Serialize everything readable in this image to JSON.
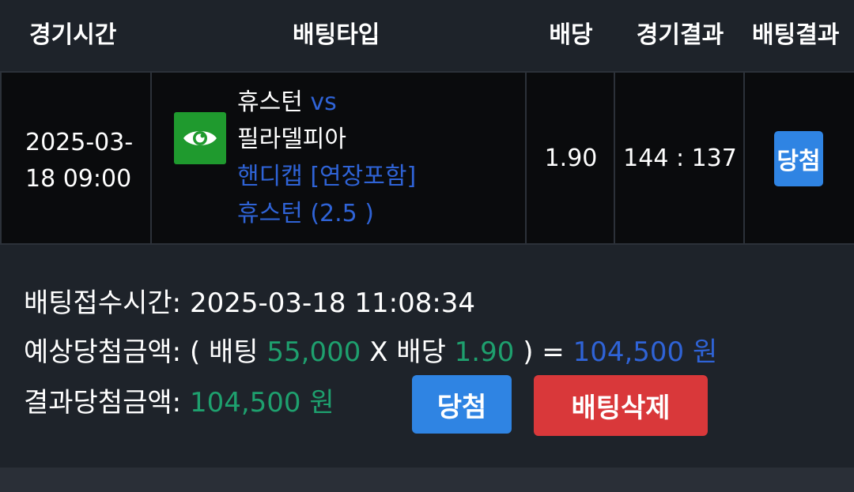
{
  "header": {
    "time": "경기시간",
    "bet_type": "배팅타입",
    "odds": "배당",
    "match_result": "경기결과",
    "bet_result": "배팅결과"
  },
  "row": {
    "time_line1": "2025-03-",
    "time_line2": "18 09:00",
    "icon": "eye-icon",
    "home_team": "휴스턴",
    "vs": "vs",
    "away_team": "필라델피아",
    "market": "핸디캡 [연장포함]",
    "pick": "휴스턴 (2.5 )",
    "odds": "1.90",
    "score": "144 : 137",
    "bet_result_badge": "당첨"
  },
  "summary": {
    "receipt_label": "배팅접수시간:",
    "receipt_time": "2025-03-18 11:08:34",
    "expected_label": "예상당첨금액:",
    "expected_open": "( 배팅",
    "stake": "55,000",
    "times": "X 배당",
    "expected_odds": "1.90",
    "expected_close": ") =",
    "expected_amount": "104,500 원",
    "actual_label": "결과당첨금액:",
    "actual_amount": "104,500 원",
    "win_button": "당첨",
    "delete_button": "배팅삭제"
  },
  "colors": {
    "background": "#1e232a",
    "row_background": "#0a0b0d",
    "accent_blue": "#2f63d6",
    "accent_green": "#1ea06e",
    "badge_blue": "#2f84e3",
    "delete_red": "#d9383a",
    "icon_green": "#1f9a2e"
  }
}
